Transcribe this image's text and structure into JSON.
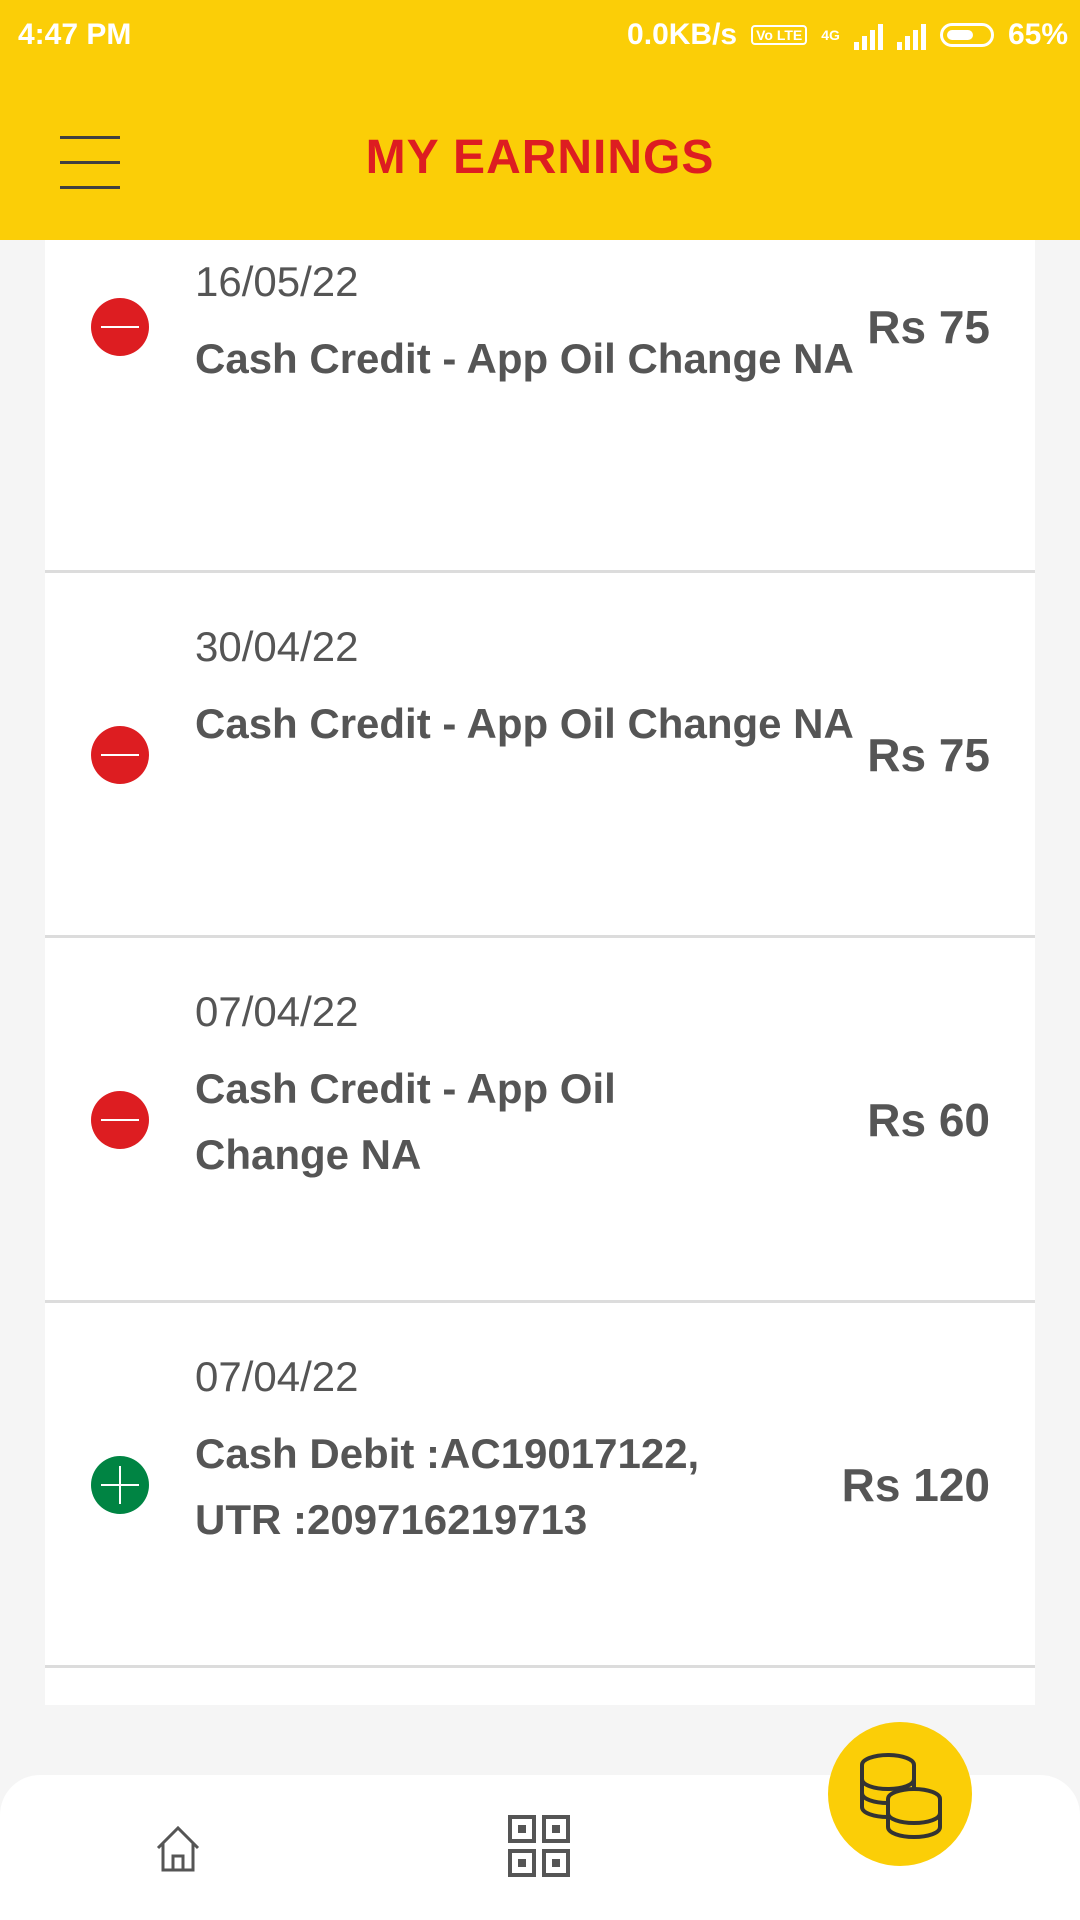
{
  "status_bar": {
    "time": "4:47 PM",
    "net_speed": "0.0KB/s",
    "volte": "Vo LTE",
    "network": "4G",
    "battery": "65%",
    "battery_level": 0.65
  },
  "header": {
    "title": "MY EARNINGS"
  },
  "transactions": [
    {
      "date": "16/05/22",
      "description": "Cash Credit - App Oil Change NA",
      "amount": "Rs 75",
      "type": "minus"
    },
    {
      "date": "30/04/22",
      "description": "Cash Credit - App Oil Change NA",
      "amount": "Rs 75",
      "type": "minus"
    },
    {
      "date": "07/04/22",
      "description": "Cash Credit - App Oil Change NA",
      "amount": "Rs 60",
      "type": "minus"
    },
    {
      "date": "07/04/22",
      "description": "Cash Debit :AC19017122, UTR :209716219713",
      "amount": "Rs 120",
      "type": "plus"
    }
  ],
  "bottom_nav": [
    {
      "icon": "home-icon"
    },
    {
      "icon": "qr-code-icon"
    },
    {
      "icon": "coins-icon",
      "active": true
    }
  ],
  "colors": {
    "brand_yellow": "#fbce07",
    "brand_red": "#dd1d21",
    "credit_green": "#008443"
  }
}
